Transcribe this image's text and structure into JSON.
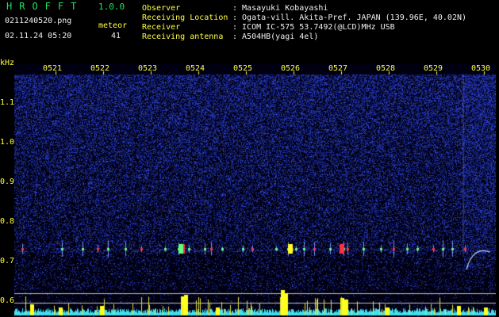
{
  "app": {
    "title": "HROFFT",
    "version": "1.0.0"
  },
  "file": {
    "name": "0211240520.png",
    "timestamp": "02.11.24 05:20"
  },
  "counter": {
    "label": "meteor",
    "value": "41"
  },
  "info": [
    {
      "key": "Observer",
      "value": ": Masayuki Kobayashi"
    },
    {
      "key": "Receiving Location",
      "value": ": Ogata-vill. Akita-Pref. JAPAN (139.96E, 40.02N)"
    },
    {
      "key": "Receiver",
      "value": ": ICOM IC-575 53.7492(@LCD)MHz USB"
    },
    {
      "key": "Receiving antenna",
      "value": ": A504HB(yagi 4el)"
    }
  ],
  "axis": {
    "unit": "kHz",
    "y_ticks": [
      "1.1",
      "1.0",
      "0.9",
      "0.8",
      "0.7",
      "0.6"
    ],
    "x_ticks": [
      "0521",
      "0522",
      "0523",
      "0524",
      "0525",
      "0526",
      "0527",
      "0528",
      "0529",
      "0530"
    ]
  },
  "colors": {
    "background": "#000000",
    "title": "#20e060",
    "label": "#ffff40",
    "text": "#f0f0f0",
    "noise": "#2030a0",
    "meteor_core": "#ff3040",
    "spectrum_fill": "#40e0f0",
    "spectrum_peak": "#ffff20"
  }
}
